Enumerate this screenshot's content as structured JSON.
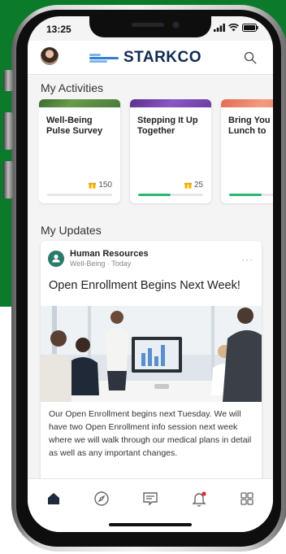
{
  "status": {
    "time": "13:25"
  },
  "header": {
    "brand": "STARKCO",
    "avatar": "user-avatar",
    "search_icon": "search-icon"
  },
  "activities": {
    "title": "My Activities",
    "cards": [
      {
        "title": "Well-Being Pulse Survey",
        "points": "150",
        "band_color": "#4a7a3a",
        "progress": 0
      },
      {
        "title": "Stepping It Up Together",
        "points": "25",
        "band_color": "#6b3fa0",
        "progress": 0.5
      },
      {
        "title": "Bring You Lunch to",
        "points": "",
        "band_color": "#e8806a",
        "progress": 0.5
      }
    ]
  },
  "updates": {
    "title": "My Updates",
    "post": {
      "author": "Human Resources",
      "category": "Well-Being",
      "time": "Today",
      "title": "Open Enrollment Begins Next Week!",
      "body": "Our Open Enrollment begins next Tuesday. We will have two Open Enrollment info session next week where we will walk through our medical plans in detail as well as any important changes.",
      "more": "···"
    }
  },
  "tabs": [
    "home-icon",
    "compass-icon",
    "feed-icon",
    "bell-icon",
    "grid-icon"
  ],
  "colors": {
    "accent": "#2bb673",
    "brand": "#0f2a52",
    "logo_blue": "#2e7fd6",
    "background_green": "#0b7a2a",
    "notification": "#e02b2b"
  }
}
